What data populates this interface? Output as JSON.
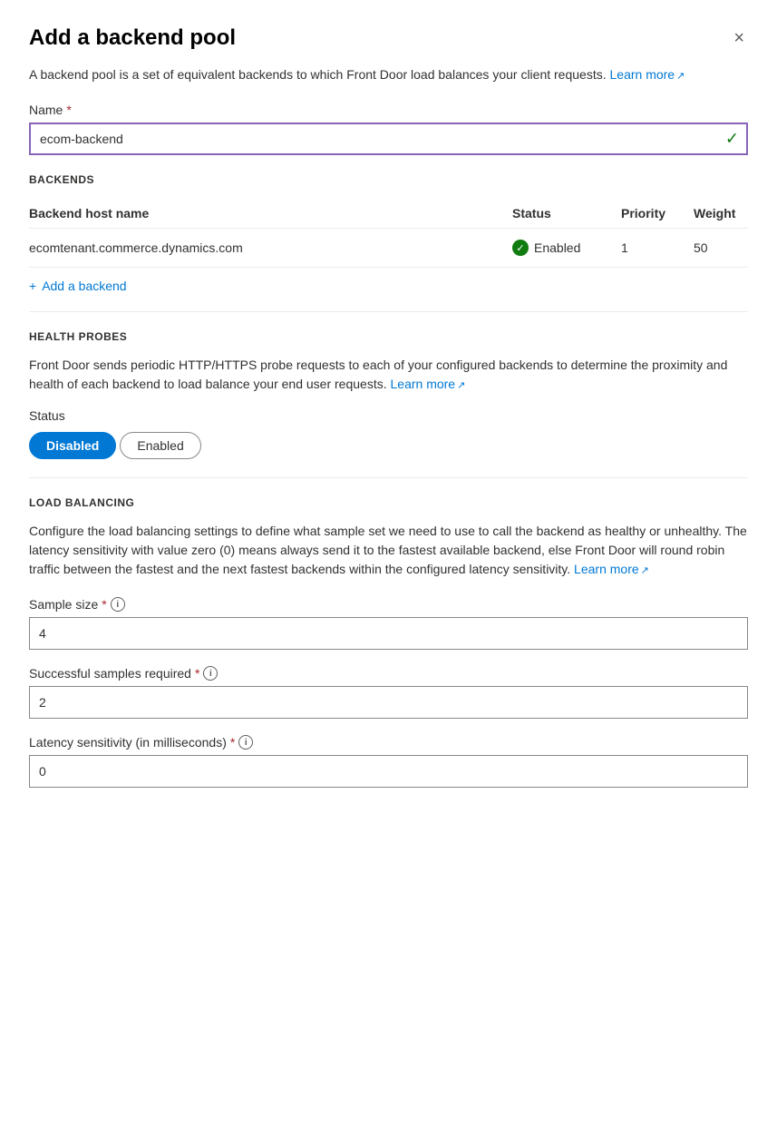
{
  "panel": {
    "title": "Add a backend pool",
    "close_label": "×",
    "description": "A backend pool is a set of equivalent backends to which Front Door load balances your client requests.",
    "learn_more_text": "Learn more",
    "external_icon": "↗"
  },
  "name_field": {
    "label": "Name",
    "required": "*",
    "value": "ecom-backend",
    "placeholder": ""
  },
  "backends_section": {
    "title": "BACKENDS",
    "columns": {
      "host_name": "Backend host name",
      "status": "Status",
      "priority": "Priority",
      "weight": "Weight"
    },
    "rows": [
      {
        "host_name": "ecomtenant.commerce.dynamics.com",
        "status": "Enabled",
        "priority": "1",
        "weight": "50"
      }
    ],
    "add_backend_label": "Add a backend"
  },
  "health_probes_section": {
    "title": "HEALTH PROBES",
    "description": "Front Door sends periodic HTTP/HTTPS probe requests to each of your configured backends to determine the proximity and health of each backend to load balance your end user requests.",
    "learn_more_text": "Learn more",
    "external_icon": "↗",
    "status_label": "Status",
    "toggle_options": [
      "Disabled",
      "Enabled"
    ],
    "active_toggle": "Disabled"
  },
  "load_balancing_section": {
    "title": "LOAD BALANCING",
    "description": "Configure the load balancing settings to define what sample set we need to use to call the backend as healthy or unhealthy. The latency sensitivity with value zero (0) means always send it to the fastest available backend, else Front Door will round robin traffic between the fastest and the next fastest backends within the configured latency sensitivity.",
    "learn_more_text": "Learn more",
    "external_icon": "↗",
    "sample_size": {
      "label": "Sample size",
      "required": "*",
      "value": "4"
    },
    "successful_samples": {
      "label": "Successful samples required",
      "required": "*",
      "value": "2"
    },
    "latency_sensitivity": {
      "label": "Latency sensitivity (in milliseconds)",
      "required": "*",
      "value": "0"
    }
  },
  "colors": {
    "accent": "#0078d4",
    "required": "#a4262c",
    "success": "#107c10",
    "border_active": "#8764b8"
  }
}
